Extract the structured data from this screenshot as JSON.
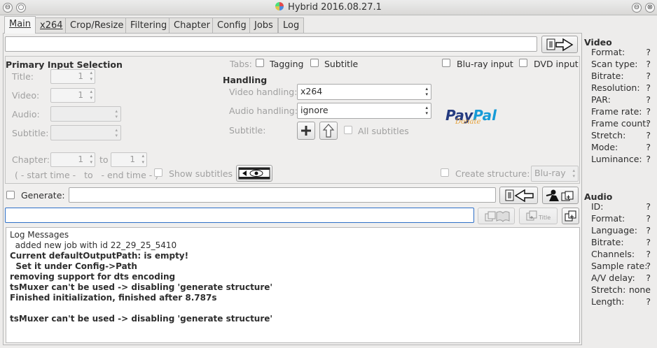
{
  "window": {
    "title": "Hybrid 2016.08.27.1",
    "controls": [
      "⊖",
      "○"
    ],
    "right_controls": [
      "⊖",
      "⊗"
    ]
  },
  "tabs": [
    "Main",
    "x264",
    "Crop/Resize",
    "Filtering",
    "Chapter",
    "Config",
    "Jobs",
    "Log"
  ],
  "input": {
    "value": ""
  },
  "primary": {
    "title": "Primary Input Selection",
    "title_label": "Title:",
    "title_value": "1",
    "video_label": "Video:",
    "video_value": "1",
    "audio_label": "Audio:",
    "subtitle_label": "Subtitle:",
    "chapter_label": "Chapter:",
    "chapter_from": "1",
    "to_label": "to",
    "chapter_to": "1",
    "time_hint": "( - start time -   to   - end time - )",
    "show_subtitles": "Show subtitles"
  },
  "tabs_opts": {
    "label": "Tabs:",
    "tagging": "Tagging",
    "subtitle": "Subtitle",
    "bluray": "Blu-ray input",
    "dvd": "DVD input"
  },
  "handling": {
    "title": "Handling",
    "video_label": "Video handling:",
    "video_value": "x264",
    "audio_label": "Audio handling:",
    "audio_value": "ignore",
    "subtitle_label": "Subtitle:",
    "all_subtitles": "All subtitles",
    "create_structure": "Create structure:",
    "structure_value": "Blu-ray"
  },
  "paypal": {
    "text1": "Pay",
    "text2": "Pal",
    "sub": "Donate"
  },
  "generate": {
    "label": "Generate:",
    "value": ""
  },
  "job_name": {
    "value": ""
  },
  "icons": {
    "title_btn_label": "Title"
  },
  "log": {
    "header": "Log Messages",
    "lines": [
      {
        "text": "  added new job with id 22_29_25_5410",
        "bold": false
      },
      {
        "text": "Current defaultOutputPath: is empty!",
        "bold": true
      },
      {
        "text": "  Set it under Config->Path",
        "bold": true
      },
      {
        "text": "removing support for dts encoding",
        "bold": true
      },
      {
        "text": "tsMuxer can't be used -> disabling 'generate structure'",
        "bold": true
      },
      {
        "text": "Finished initialization, finished after 8.787s",
        "bold": true
      },
      {
        "text": "",
        "bold": false
      },
      {
        "text": "tsMuxer can't be used -> disabling 'generate structure'",
        "bold": true
      }
    ]
  },
  "video_info": {
    "header": "Video",
    "rows": [
      {
        "label": "Format:",
        "value": "?"
      },
      {
        "label": "Scan type:",
        "value": "?"
      },
      {
        "label": "Bitrate:",
        "value": "?"
      },
      {
        "label": "Resolution:",
        "value": "?"
      },
      {
        "label": "PAR:",
        "value": "?"
      },
      {
        "label": "Frame rate:",
        "value": "?"
      },
      {
        "label": "Frame count:",
        "value": "?"
      },
      {
        "label": "Stretch:",
        "value": "?"
      },
      {
        "label": "Mode:",
        "value": "?"
      },
      {
        "label": "Luminance:",
        "value": "?"
      }
    ]
  },
  "audio_info": {
    "header": "Audio",
    "rows": [
      {
        "label": "ID:",
        "value": "?"
      },
      {
        "label": "Format:",
        "value": "?"
      },
      {
        "label": "Language:",
        "value": "?"
      },
      {
        "label": "Bitrate:",
        "value": "?"
      },
      {
        "label": "Channels:",
        "value": "?"
      },
      {
        "label": "Sample rate:",
        "value": "?"
      },
      {
        "label": "A/V delay:",
        "value": "?"
      },
      {
        "label": "Stretch:",
        "value": "none"
      },
      {
        "label": "Length:",
        "value": "?"
      }
    ]
  },
  "colors": {
    "accent": "#1a5fb4",
    "paypal_dark": "#253b80",
    "paypal_light": "#179bd7",
    "donate": "#e8a23a"
  }
}
